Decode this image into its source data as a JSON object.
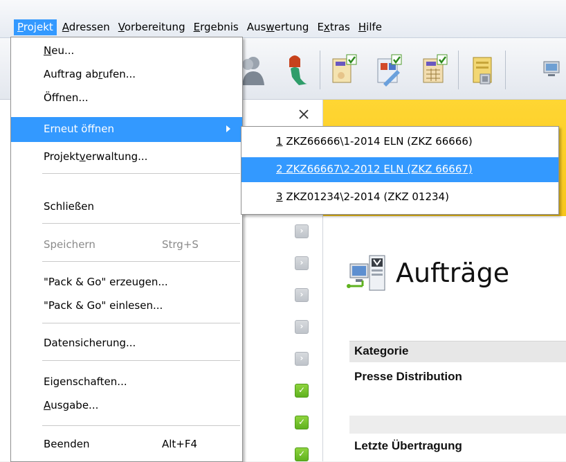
{
  "menubar": {
    "items": [
      {
        "pre": "",
        "u": "P",
        "post": "rojekt"
      },
      {
        "pre": "",
        "u": "A",
        "post": "dressen"
      },
      {
        "pre": "",
        "u": "V",
        "post": "orbereitung"
      },
      {
        "pre": "",
        "u": "E",
        "post": "rgebnis"
      },
      {
        "pre": "Aus",
        "u": "w",
        "post": "ertung"
      },
      {
        "pre": "E",
        "u": "x",
        "post": "tras"
      },
      {
        "pre": "",
        "u": "H",
        "post": "ilfe"
      }
    ]
  },
  "toolbar": {
    "icons": [
      "users-icon",
      "mermaid-icon",
      "document-check-icon",
      "document-edit-icon",
      "document-grid-icon",
      "database-icon",
      "network-icon"
    ]
  },
  "projekt_menu": {
    "items": [
      {
        "pre": "",
        "u": "N",
        "post": "eu...",
        "shortcut": "",
        "state": "normal"
      },
      {
        "pre": "Auftrag ab",
        "u": "r",
        "post": "ufen...",
        "shortcut": "",
        "state": "normal"
      },
      {
        "pre": "Öffnen...",
        "u": "",
        "post": "",
        "shortcut": "",
        "state": "normal"
      },
      {
        "pre": "Erneut öffnen",
        "u": "",
        "post": "",
        "shortcut": "",
        "state": "highlight"
      },
      {
        "pre": "Projekt",
        "u": "v",
        "post": "erwaltung...",
        "shortcut": "",
        "state": "normal"
      },
      {
        "pre": "Schließen",
        "u": "",
        "post": "",
        "shortcut": "",
        "state": "normal"
      },
      {
        "pre": "Speichern",
        "u": "",
        "post": "",
        "shortcut": "Strg+S",
        "state": "disabled"
      },
      {
        "pre": "\"Pack & Go\" erzeugen...",
        "u": "",
        "post": "",
        "shortcut": "",
        "state": "normal"
      },
      {
        "pre": "\"Pack & Go\" einlesen...",
        "u": "",
        "post": "",
        "shortcut": "",
        "state": "normal"
      },
      {
        "pre": "Datensicherung...",
        "u": "",
        "post": "",
        "shortcut": "",
        "state": "normal"
      },
      {
        "pre": "Eigenschaften...",
        "u": "",
        "post": "",
        "shortcut": "",
        "state": "normal"
      },
      {
        "pre": "",
        "u": "A",
        "post": "usgabe...",
        "shortcut": "",
        "state": "normal"
      },
      {
        "pre": "Beenden",
        "u": "",
        "post": "",
        "shortcut": "Alt+F4",
        "state": "normal"
      }
    ]
  },
  "recent_submenu": {
    "items": [
      {
        "num": "1",
        "label": " ZKZ66666\\1-2014 ELN  (ZKZ 66666)",
        "state": "normal"
      },
      {
        "num": "2",
        "label": " ZKZ66667\\2-2012 ELN  (ZKZ 66667)",
        "state": "highlight"
      },
      {
        "num": "3",
        "label": " ZKZ01234\\2-2014 (ZKZ 01234)",
        "state": "normal"
      }
    ]
  },
  "content": {
    "heading": "Aufträge",
    "table_header": "Kategorie",
    "row1": "Presse Distribution",
    "row2": "Letzte Übertragung"
  },
  "status_list": [
    "grey",
    "grey",
    "grey",
    "grey",
    "grey",
    "green",
    "green",
    "green"
  ],
  "colors": {
    "menu_highlight": "#3399ff",
    "accent_yellow": "#f7c61b",
    "status_green": "#6cc22a"
  }
}
